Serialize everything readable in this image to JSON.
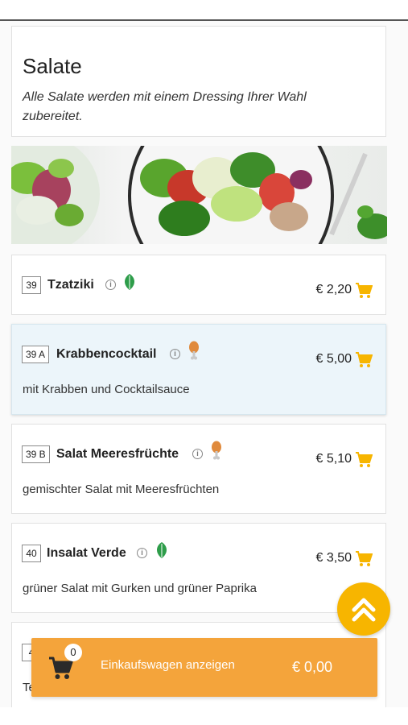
{
  "section": {
    "title": "Salate",
    "subtitle": "Alle Salate werden mit einem Dressing Ihrer Wahl zubereitet."
  },
  "items": [
    {
      "number": "39",
      "name": "Tzatziki",
      "price": "€ 2,20",
      "description": "",
      "diet_icon": "leaf-icon",
      "highlighted": false
    },
    {
      "number": "39 A",
      "name": "Krabbencocktail",
      "price": "€ 5,00",
      "description": "mit Krabben und Cocktailsauce",
      "diet_icon": "drumstick-icon",
      "highlighted": true
    },
    {
      "number": "39 B",
      "name": "Salat Meeresfrüchte",
      "price": "€ 5,10",
      "description": "gemischter Salat mit Meeresfrüchten",
      "diet_icon": "drumstick-icon",
      "highlighted": false
    },
    {
      "number": "40",
      "name": "Insalat Verde",
      "price": "€ 3,50",
      "description": "grüner Salat mit Gurken und grüner Paprika",
      "diet_icon": "leaf-icon",
      "highlighted": false
    },
    {
      "number": "4",
      "name": "",
      "price": "",
      "description": "Te",
      "diet_icon": "",
      "highlighted": false
    }
  ],
  "cart": {
    "label": "Einkaufswagen anzeigen",
    "count": "0",
    "total": "€ 0,00"
  },
  "colors": {
    "accent": "#f7b500",
    "cart_bar": "#f4a43b",
    "veg_green": "#2e9d4a",
    "meat_orange": "#e08a3c",
    "highlight_bg": "#ecf5fa"
  }
}
